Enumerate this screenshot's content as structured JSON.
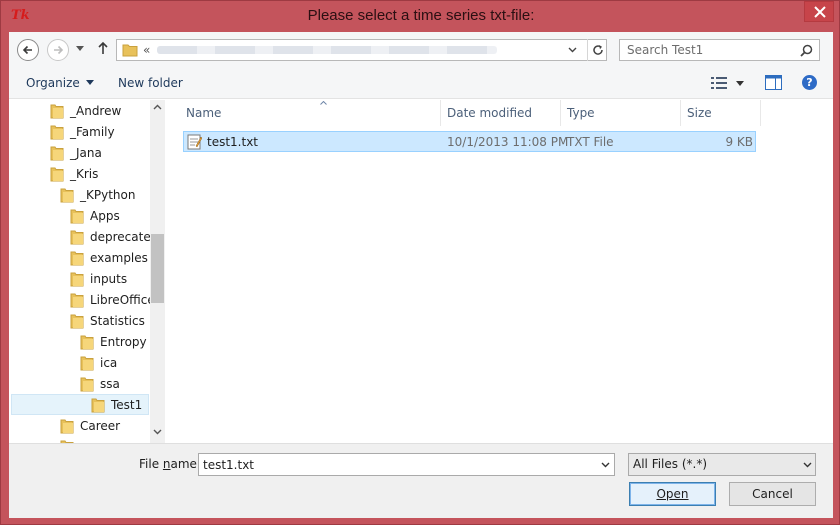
{
  "window": {
    "title": "Please select a time series txt-file:",
    "app_icon": "tk-icon",
    "accent": "#c4545c"
  },
  "nav": {
    "address_prefix": "«",
    "search_placeholder": "Search Test1"
  },
  "toolbar": {
    "organize_label": "Organize",
    "new_folder_label": "New folder"
  },
  "tree": {
    "items": [
      {
        "label": "_Andrew"
      },
      {
        "label": "_Family"
      },
      {
        "label": "_Jana"
      },
      {
        "label": "_Kris"
      },
      {
        "label": "_KPython"
      },
      {
        "label": "Apps"
      },
      {
        "label": "deprecated"
      },
      {
        "label": "examples"
      },
      {
        "label": "inputs"
      },
      {
        "label": "LibreOffice"
      },
      {
        "label": "Statistics"
      },
      {
        "label": "Entropy"
      },
      {
        "label": "ica"
      },
      {
        "label": "ssa"
      },
      {
        "label": "Test1"
      },
      {
        "label": "Career"
      }
    ],
    "selected": "Test1"
  },
  "columns": {
    "name": "Name",
    "date": "Date modified",
    "type": "Type",
    "size": "Size"
  },
  "files": [
    {
      "name": "test1.txt",
      "date": "10/1/2013 11:08 PM",
      "type": "TXT File",
      "size": "9 KB"
    }
  ],
  "bottom": {
    "filename_label_pre": "File ",
    "filename_label_u": "n",
    "filename_label_post": "ame:",
    "filename_value": "test1.txt",
    "filter_value": "All Files (*.*)",
    "open_label": "Open",
    "cancel_label": "Cancel"
  }
}
